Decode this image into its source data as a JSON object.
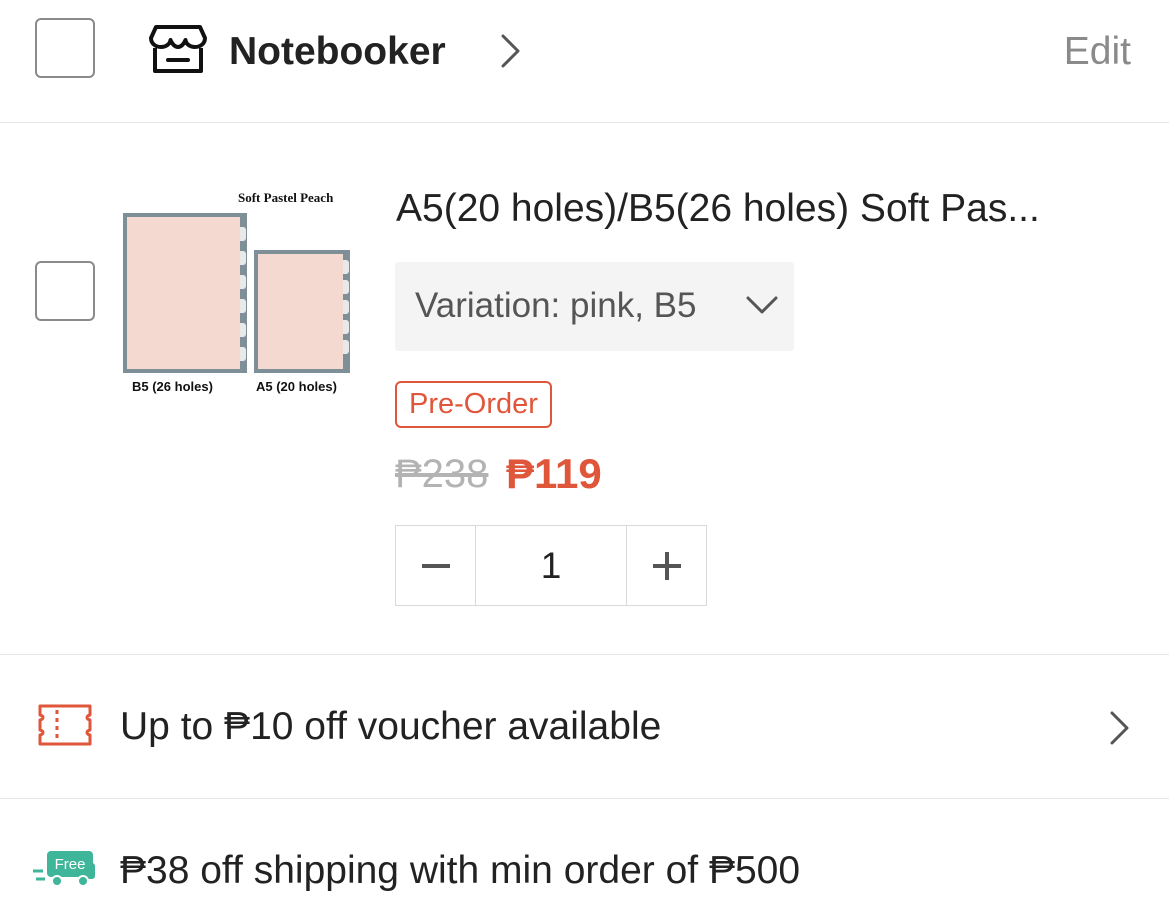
{
  "shop": {
    "name": "Notebooker",
    "edit_label": "Edit",
    "icon": "store-icon"
  },
  "product": {
    "image_caption_top": "Soft Pastel Peach",
    "image_caption_left": "B5 (26 holes)",
    "image_caption_right": "A5 (20 holes)",
    "title": "A5(20 holes)/B5(26 holes) Soft Pas...",
    "variation": "Variation: pink, B5",
    "badge": "Pre-Order",
    "original_price": "₱238",
    "price": "₱119",
    "quantity": "1"
  },
  "voucher": {
    "text": "Up to ₱10 off voucher available",
    "icon": "voucher-ticket-icon"
  },
  "shipping": {
    "icon_label": "Free",
    "text": "₱38 off shipping with min order of ₱500",
    "icon": "free-shipping-truck-icon"
  },
  "colors": {
    "accent": "#e0563a",
    "free_shipping": "#3fb59a",
    "muted_text": "#8a8a8a",
    "strikethrough": "#b3b3b3"
  }
}
